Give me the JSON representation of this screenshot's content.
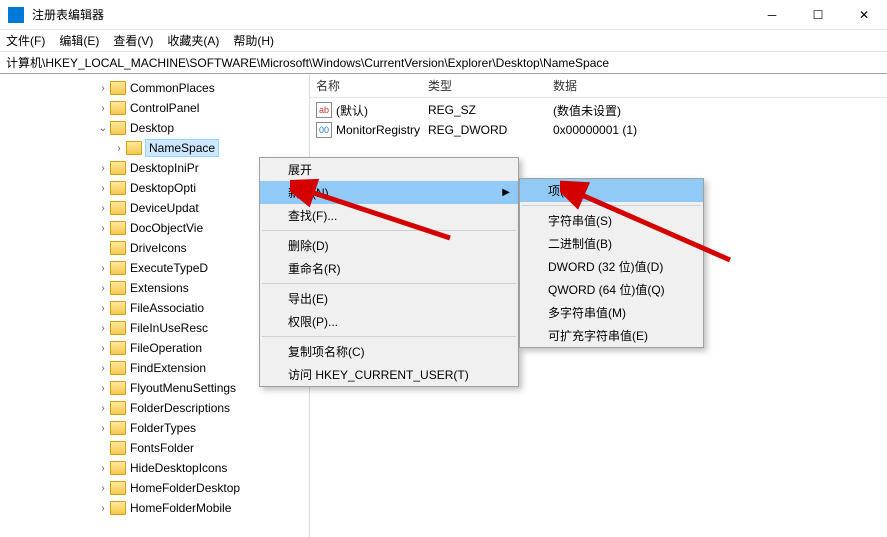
{
  "window": {
    "title": "注册表编辑器"
  },
  "menu": {
    "file": "文件(F)",
    "edit": "编辑(E)",
    "view": "查看(V)",
    "fav": "收藏夹(A)",
    "help": "帮助(H)"
  },
  "address": "计算机\\HKEY_LOCAL_MACHINE\\SOFTWARE\\Microsoft\\Windows\\CurrentVersion\\Explorer\\Desktop\\NameSpace",
  "columns": {
    "name": "名称",
    "type": "类型",
    "data": "数据"
  },
  "values": [
    {
      "icon": "sz",
      "iconText": "ab",
      "name": "(默认)",
      "type": "REG_SZ",
      "data": "(数值未设置)"
    },
    {
      "icon": "dw",
      "iconText": "00",
      "name": "MonitorRegistry",
      "type": "REG_DWORD",
      "data": "0x00000001 (1)"
    }
  ],
  "tree": [
    {
      "depth": 6,
      "exp": ">",
      "label": "CommonPlaces"
    },
    {
      "depth": 6,
      "exp": ">",
      "label": "ControlPanel"
    },
    {
      "depth": 6,
      "exp": "v",
      "label": "Desktop"
    },
    {
      "depth": 7,
      "exp": ">",
      "label": "NameSpace",
      "sel": true
    },
    {
      "depth": 6,
      "exp": ">",
      "label": "DesktopIniPr"
    },
    {
      "depth": 6,
      "exp": ">",
      "label": "DesktopOpti"
    },
    {
      "depth": 6,
      "exp": ">",
      "label": "DeviceUpdat"
    },
    {
      "depth": 6,
      "exp": ">",
      "label": "DocObjectVie"
    },
    {
      "depth": 6,
      "exp": "",
      "label": "DriveIcons"
    },
    {
      "depth": 6,
      "exp": ">",
      "label": "ExecuteTypeD"
    },
    {
      "depth": 6,
      "exp": ">",
      "label": "Extensions"
    },
    {
      "depth": 6,
      "exp": ">",
      "label": "FileAssociatio"
    },
    {
      "depth": 6,
      "exp": ">",
      "label": "FileInUseResc"
    },
    {
      "depth": 6,
      "exp": ">",
      "label": "FileOperation"
    },
    {
      "depth": 6,
      "exp": ">",
      "label": "FindExtension"
    },
    {
      "depth": 6,
      "exp": ">",
      "label": "FlyoutMenuSettings"
    },
    {
      "depth": 6,
      "exp": ">",
      "label": "FolderDescriptions"
    },
    {
      "depth": 6,
      "exp": ">",
      "label": "FolderTypes"
    },
    {
      "depth": 6,
      "exp": "",
      "label": "FontsFolder"
    },
    {
      "depth": 6,
      "exp": ">",
      "label": "HideDesktopIcons"
    },
    {
      "depth": 6,
      "exp": ">",
      "label": "HomeFolderDesktop"
    },
    {
      "depth": 6,
      "exp": ">",
      "label": "HomeFolderMobile"
    }
  ],
  "ctx": {
    "expand": "展开",
    "new": "新建(N)",
    "find": "查找(F)...",
    "delete": "删除(D)",
    "rename": "重命名(R)",
    "export": "导出(E)",
    "perm": "权限(P)...",
    "copyname": "复制项名称(C)",
    "gohkcu": "访问 HKEY_CURRENT_USER(T)"
  },
  "sub": {
    "key": "项(K)",
    "string": "字符串值(S)",
    "binary": "二进制值(B)",
    "dword": "DWORD (32 位)值(D)",
    "qword": "QWORD (64 位)值(Q)",
    "multi": "多字符串值(M)",
    "expand": "可扩充字符串值(E)"
  }
}
